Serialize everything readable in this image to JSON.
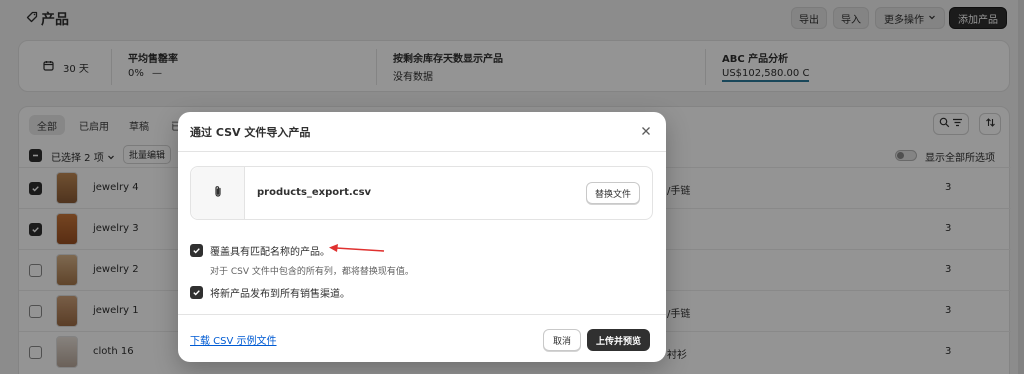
{
  "header": {
    "title": "产品",
    "export_label": "导出",
    "import_label": "导入",
    "more_label": "更多操作",
    "add_label": "添加产品"
  },
  "stats": {
    "period": "30 天",
    "avg_sell_through": {
      "title": "平均售罄率",
      "value": "0%",
      "trend": "—"
    },
    "days_inventory": {
      "title": "按剩余库存天数显示产品",
      "value": "没有数据"
    },
    "abc": {
      "title": "ABC 产品分析",
      "value": "US$102,580.00 C"
    }
  },
  "list": {
    "tabs": [
      {
        "label": "全部"
      },
      {
        "label": "已启用"
      },
      {
        "label": "草稿"
      },
      {
        "label": "已"
      }
    ],
    "selected_label": "已选择 2 项",
    "bulk_edit_label": "批量编辑",
    "show_all_label": "显示全部所选项",
    "rows": [
      {
        "name": "jewelry 4",
        "category": "/手链",
        "qty": "3",
        "checked": true
      },
      {
        "name": "jewelry 3",
        "category": "",
        "qty": "3",
        "checked": true
      },
      {
        "name": "jewelry 2",
        "category": "",
        "qty": "3",
        "checked": false
      },
      {
        "name": "jewelry 1",
        "category": "/手链",
        "qty": "3",
        "checked": false
      },
      {
        "name": "cloth 16",
        "category": "衬衫",
        "qty": "3",
        "checked": false
      }
    ]
  },
  "modal": {
    "title": "通过 CSV 文件导入产品",
    "file_name": "products_export.csv",
    "replace_label": "替换文件",
    "overwrite_label": "覆盖具有匹配名称的产品。",
    "overwrite_help": "对于 CSV 文件中包含的所有列，都将替换现有值。",
    "publish_label": "将新产品发布到所有销售渠道。",
    "download_link": "下载 CSV 示例文件",
    "cancel_label": "取消",
    "upload_label": "上传并预览"
  },
  "colors": {
    "primary": "#303030",
    "link": "#005bd3",
    "annotation_arrow": "#e0312f"
  }
}
